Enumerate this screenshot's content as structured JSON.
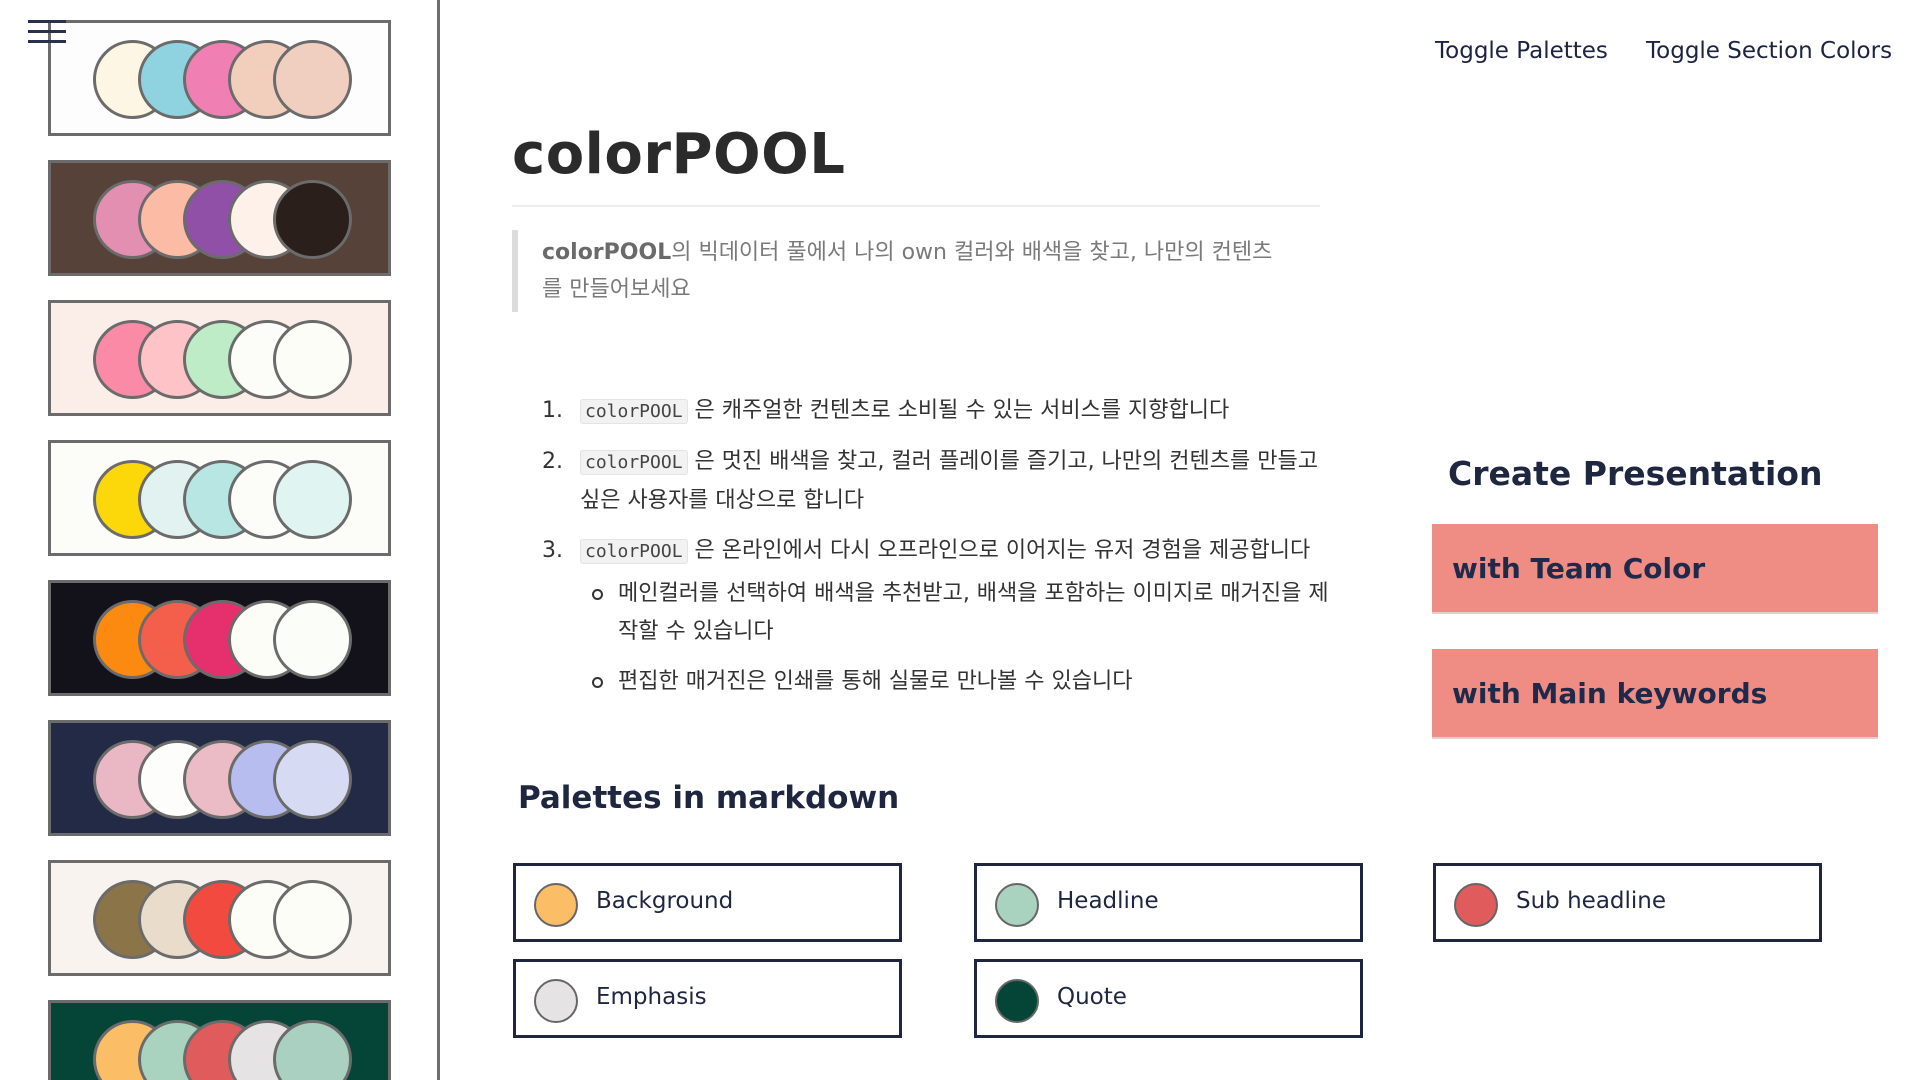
{
  "nav": {
    "menu_icon": "hamburger-icon",
    "toggle_palettes": "Toggle Palettes",
    "toggle_section_colors": "Toggle Section Colors"
  },
  "sidebar": {
    "palettes": [
      {
        "bg": "#fdfdfd",
        "circles": [
          "#fdf6e4",
          "#8fd3e0",
          "#f080b4",
          "#f2cfbd",
          "#f0cfc0"
        ]
      },
      {
        "bg": "#57423a",
        "circles": [
          "#e38fb2",
          "#fbbba4",
          "#9150a8",
          "#fdf1ea",
          "#2a1f1b"
        ]
      },
      {
        "bg": "#fbeee8",
        "circles": [
          "#fb8aa7",
          "#fdc3c6",
          "#bdecc7",
          "#fcfdf8",
          "#fdfdf8"
        ]
      },
      {
        "bg": "#fcfdf8",
        "circles": [
          "#fcd70a",
          "#e2f2f0",
          "#b8e6e2",
          "#fcfdf8",
          "#e0f4f2"
        ]
      },
      {
        "bg": "#13121a",
        "circles": [
          "#fd8a10",
          "#f45f4b",
          "#e6306e",
          "#fdfdf8",
          "#fbfdf8"
        ]
      },
      {
        "bg": "#232a45",
        "circles": [
          "#eab8c5",
          "#fdfdfb",
          "#ebbcc6",
          "#b7bdee",
          "#d7daf3"
        ]
      },
      {
        "bg": "#f8f3ef",
        "circles": [
          "#8b7548",
          "#e9dcca",
          "#f24a3e",
          "#fdfdf8",
          "#fdfdf8"
        ]
      },
      {
        "bg": "#054538",
        "circles": [
          "#fbbd65",
          "#a9d2bf",
          "#e05c5c",
          "#e6e3e4",
          "#a9d0c0"
        ]
      }
    ]
  },
  "main": {
    "title": "colorPOOL",
    "quote_bold": "colorPOOL",
    "quote_text": "의 빅데이터 풀에서 나의 own 컬러와 배색을 찾고, 나만의 컨텐츠",
    "quote_tail": "를 만들어보세요",
    "ordered": [
      {
        "num": "1.",
        "code": "colorPOOL",
        "text": " 은 캐주얼한 컨텐츠로 소비될 수 있는 서비스를 지향합니다"
      },
      {
        "num": "2.",
        "code": "colorPOOL",
        "text": " 은 멋진 배색을 찾고, 컬러 플레이를 즐기고, 나만의 컨텐츠를 만들고 싶은 사용자를 대상으로 합니다"
      },
      {
        "num": "3.",
        "code": "colorPOOL",
        "text": " 은 온라인에서 다시 오프라인으로 이어지는 유저 경험을 제공합니다"
      }
    ],
    "sub_items": [
      "메인컬러를 선택하여 배색을 추천받고, 배색을 포함하는 이미지로 매거진을 제작할 수 있습니다",
      "편집한 매거진은 인쇄를 통해 실물로 만나볼 수 있습니다"
    ]
  },
  "presentation": {
    "heading": "Create Presentation",
    "team_color": "with Team Color",
    "main_keywords": "with Main keywords",
    "button_color": "#ef8c84"
  },
  "markdown_palettes": {
    "heading": "Palettes in markdown",
    "items": [
      {
        "label": "Background",
        "color": "#fbbd65"
      },
      {
        "label": "Headline",
        "color": "#a9d2bf"
      },
      {
        "label": "Sub headline",
        "color": "#e05c5c"
      },
      {
        "label": "Emphasis",
        "color": "#e6e3e4"
      },
      {
        "label": "Quote",
        "color": "#054538"
      }
    ]
  }
}
